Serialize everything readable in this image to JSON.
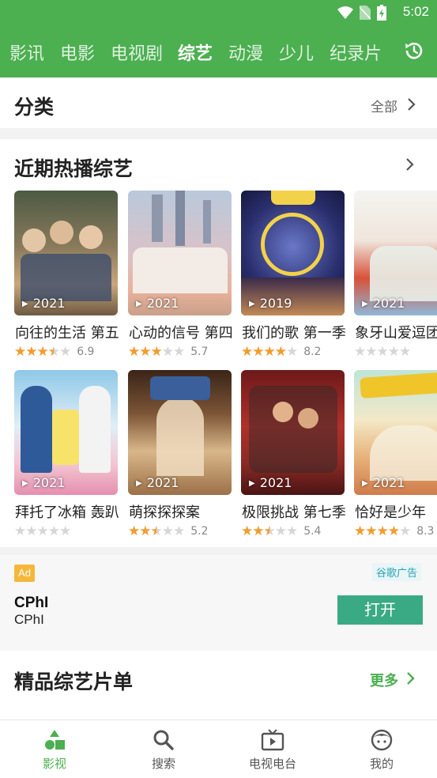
{
  "status_bar": {
    "time": "5:02"
  },
  "top_tabs": [
    {
      "label": "影讯",
      "active": false
    },
    {
      "label": "电影",
      "active": false
    },
    {
      "label": "电视剧",
      "active": false
    },
    {
      "label": "综艺",
      "active": true
    },
    {
      "label": "动漫",
      "active": false
    },
    {
      "label": "少儿",
      "active": false
    },
    {
      "label": "纪录片",
      "active": false
    }
  ],
  "category": {
    "title": "分类",
    "all_label": "全部"
  },
  "hot": {
    "title": "近期热播综艺",
    "items": [
      {
        "name": "向往的生活 第五季",
        "year": "2021",
        "stars": 3.5,
        "score": "6.9"
      },
      {
        "name": "心动的信号 第四季",
        "year": "2021",
        "stars": 3,
        "score": "5.7"
      },
      {
        "name": "我们的歌 第一季",
        "year": "2019",
        "stars": 4,
        "score": "8.2"
      },
      {
        "name": "象牙山爱逗团",
        "year": "2021",
        "stars": 0,
        "score": ""
      },
      {
        "name": "拜托了冰箱 轰趴季",
        "year": "2021",
        "stars": 0,
        "score": ""
      },
      {
        "name": "萌探探探案",
        "year": "2021",
        "stars": 2.5,
        "score": "5.2"
      },
      {
        "name": "极限挑战 第七季",
        "year": "2021",
        "stars": 2.5,
        "score": "5.4"
      },
      {
        "name": "恰好是少年",
        "year": "2021",
        "stars": 4,
        "score": "8.3"
      }
    ]
  },
  "ad": {
    "badge": "Ad",
    "network": "谷歌广告",
    "title": "CPhI",
    "subtitle": "CPhI",
    "button": "打开"
  },
  "curated": {
    "title": "精品综艺片单",
    "more_label": "更多"
  },
  "bottom_nav": [
    {
      "label": "影视",
      "icon": "shapes-icon",
      "active": true
    },
    {
      "label": "搜索",
      "icon": "search-icon",
      "active": false
    },
    {
      "label": "电视电台",
      "icon": "tv-icon",
      "active": false
    },
    {
      "label": "我的",
      "icon": "profile-face-icon",
      "active": false
    }
  ],
  "colors": {
    "brand": "#4caf50",
    "star": "#f39c2b",
    "open_button": "#3aaa85",
    "ad_badge": "#f5b73b"
  }
}
